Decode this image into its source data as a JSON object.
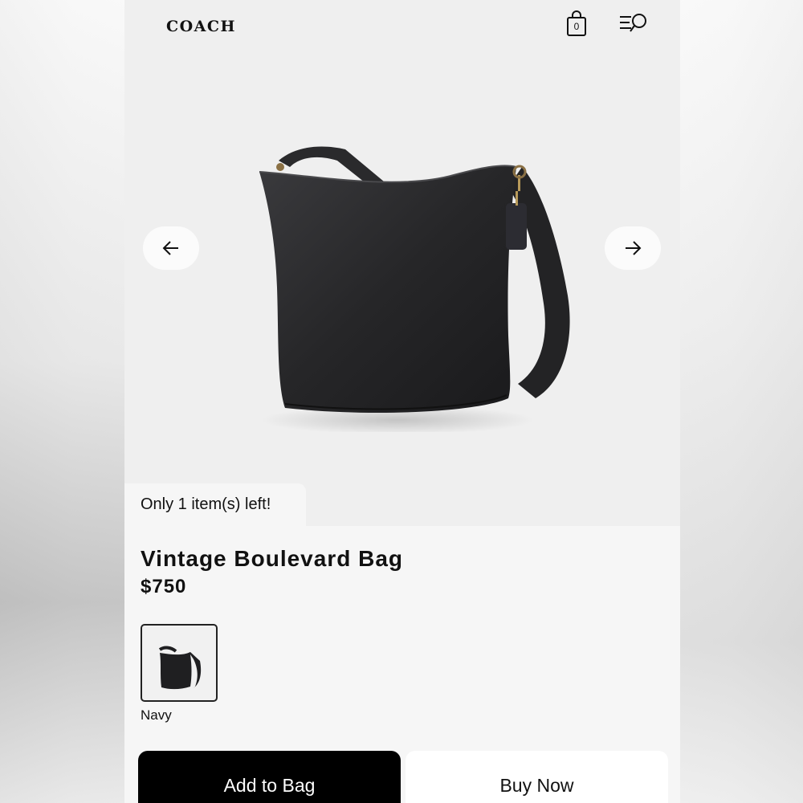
{
  "header": {
    "brand": "COACH",
    "bag_count": "0",
    "bag_icon": "shopping-bag-icon",
    "menu_icon": "menu-search-icon"
  },
  "gallery": {
    "prev_icon": "arrow-left-icon",
    "next_icon": "arrow-right-icon"
  },
  "product": {
    "stock_notice": "Only 1 item(s) left!",
    "name": "Vintage Boulevard Bag",
    "price": "$750",
    "colors": [
      {
        "label": "Navy",
        "selected": true
      }
    ]
  },
  "actions": {
    "add_to_bag": "Add to Bag",
    "buy_now": "Buy Now"
  },
  "colors": {
    "primary_button": "#000000",
    "secondary_button": "#ffffff",
    "page_background": "#f3f3f3"
  }
}
